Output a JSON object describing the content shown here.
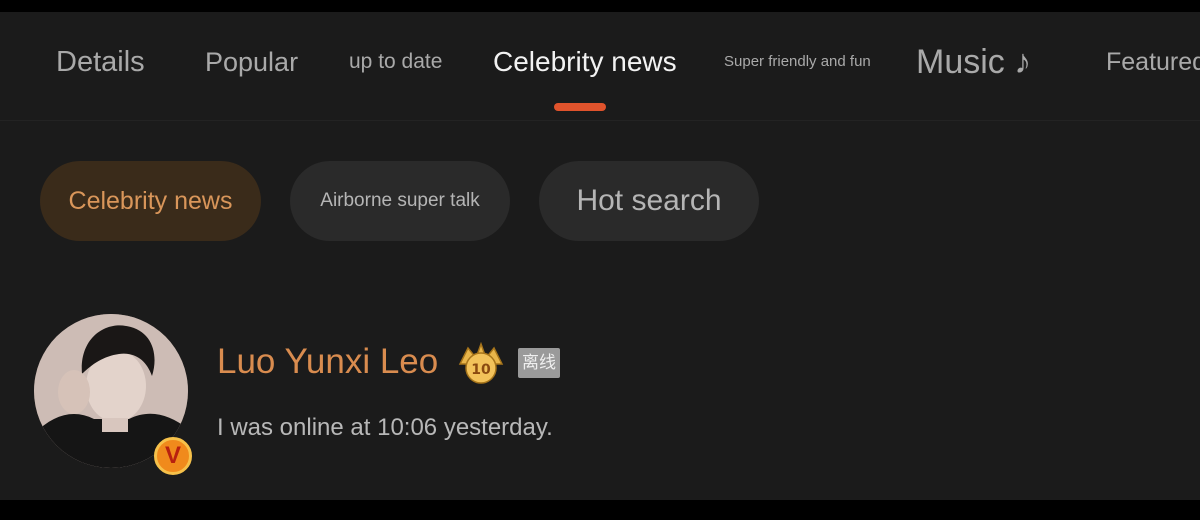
{
  "tabs": [
    {
      "label": "Details",
      "active": false
    },
    {
      "label": "Popular",
      "active": false
    },
    {
      "label": "up to date",
      "active": false
    },
    {
      "label": "Celebrity news",
      "active": true
    },
    {
      "label": "Super friendly and fun",
      "active": false
    },
    {
      "label": "Music ♪",
      "active": false
    },
    {
      "label": "Featured",
      "active": false
    }
  ],
  "chips": [
    {
      "label": "Celebrity news",
      "active": true
    },
    {
      "label": "Airborne super talk",
      "active": false
    },
    {
      "label": "Hot search",
      "active": false
    }
  ],
  "user": {
    "name": "Luo Yunxi Leo",
    "verified_badge": "V",
    "rank_badge_label": "10",
    "offline_tag": "离线",
    "status": "I was online at 10:06 yesterday."
  },
  "colors": {
    "accent": "#e0532c",
    "name_color": "#d98c4f",
    "background": "#1b1b1b"
  }
}
